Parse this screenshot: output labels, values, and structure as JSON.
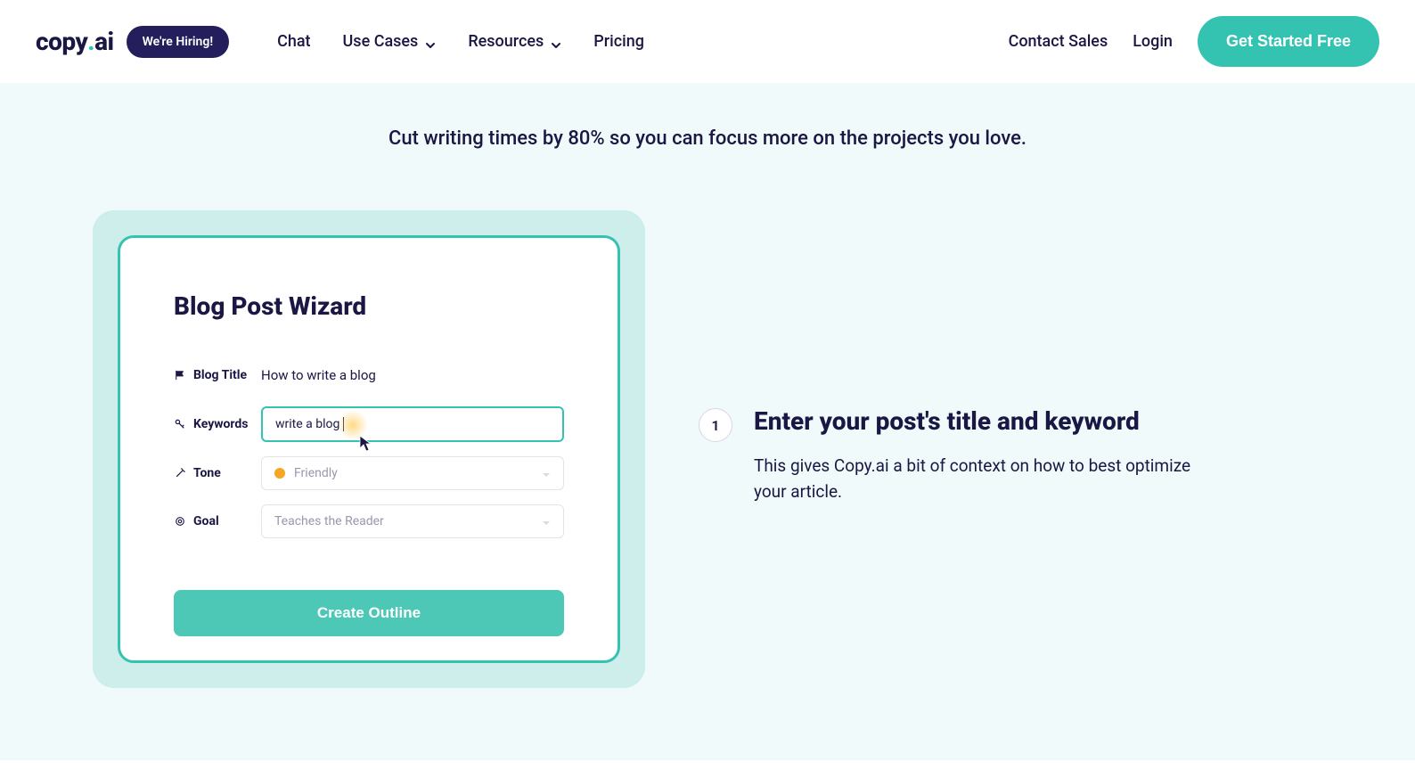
{
  "header": {
    "logo_main": "copy",
    "logo_dot": ".",
    "logo_suffix": "ai",
    "hiring_badge": "We're Hiring!",
    "nav": {
      "chat": "Chat",
      "use_cases": "Use Cases",
      "resources": "Resources",
      "pricing": "Pricing"
    },
    "contact_sales": "Contact Sales",
    "login": "Login",
    "cta": "Get Started Free"
  },
  "tagline": "Cut writing times by 80% so you can focus more on the projects you love.",
  "wizard": {
    "title": "Blog Post Wizard",
    "labels": {
      "blog_title": "Blog Title",
      "keywords": "Keywords",
      "tone": "Tone",
      "goal": "Goal"
    },
    "values": {
      "blog_title": "How to write a blog",
      "keywords": "write a blog"
    },
    "placeholders": {
      "tone": "Friendly",
      "goal": "Teaches the Reader"
    },
    "create_button": "Create Outline"
  },
  "step": {
    "number": "1",
    "title": "Enter your post's title and keyword",
    "description": "This gives Copy.ai a bit of context on how to best optimize your article."
  },
  "colors": {
    "accent": "#35c3b1",
    "dark": "#1a1744"
  }
}
